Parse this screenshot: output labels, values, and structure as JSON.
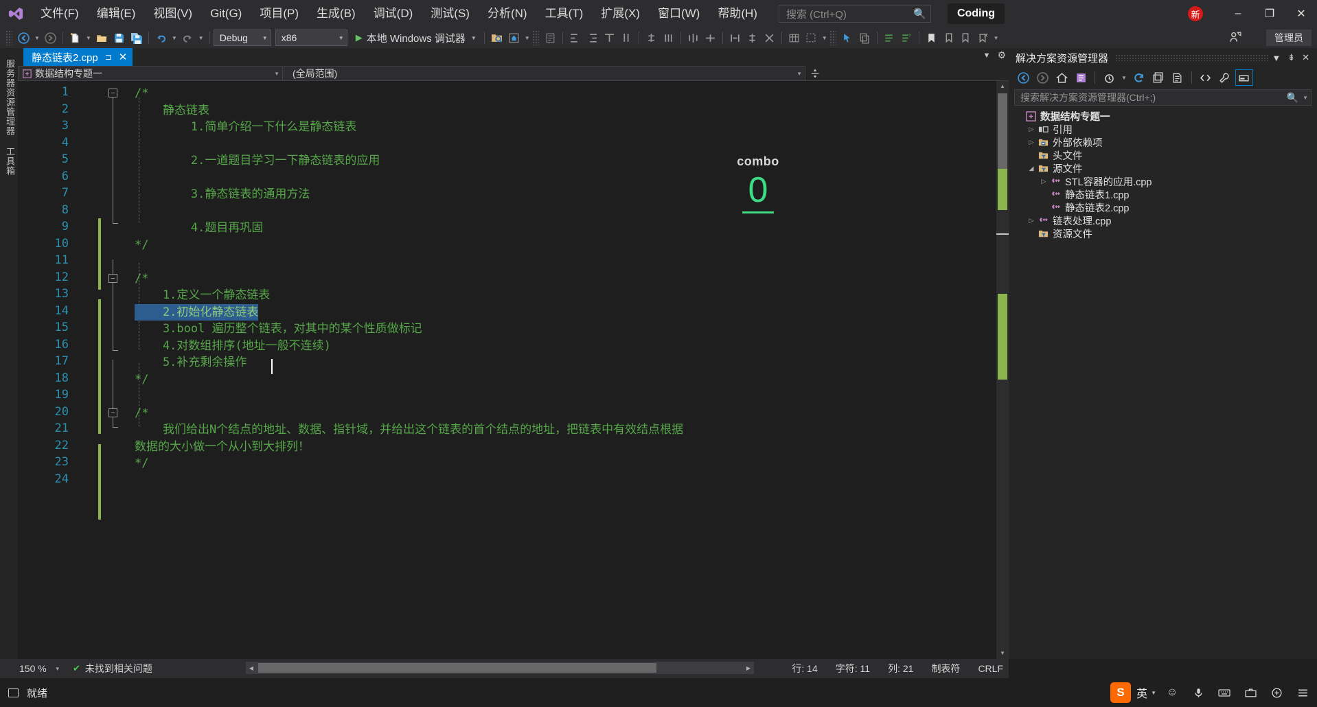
{
  "titlebar": {
    "logo_icon": "visual-studio-logo",
    "menus": [
      {
        "label": "文件(F)"
      },
      {
        "label": "编辑(E)"
      },
      {
        "label": "视图(V)"
      },
      {
        "label": "Git(G)"
      },
      {
        "label": "项目(P)"
      },
      {
        "label": "生成(B)"
      },
      {
        "label": "调试(D)"
      },
      {
        "label": "测试(S)"
      },
      {
        "label": "分析(N)"
      },
      {
        "label": "工具(T)"
      },
      {
        "label": "扩展(X)"
      },
      {
        "label": "窗口(W)"
      },
      {
        "label": "帮助(H)"
      }
    ],
    "search_placeholder": "搜索 (Ctrl+Q)",
    "search_icon": "search-icon",
    "product_tag": "Coding",
    "new_badge": "新",
    "minimize": "–",
    "restore": "❐",
    "close": "✕"
  },
  "toolbar": {
    "nav_back_icon": "arrow-back-icon",
    "nav_forward_icon": "arrow-forward-icon",
    "new_file_icon": "new-file-icon",
    "open_file_icon": "open-folder-icon",
    "save_icon": "save-icon",
    "save_all_icon": "save-all-icon",
    "undo_icon": "undo-icon",
    "redo_icon": "redo-icon",
    "config_value": "Debug",
    "platform_value": "x86",
    "run_label": "本地 Windows 调试器",
    "run_icon": "play-icon",
    "admin_label": "管理员",
    "feedback_icon": "feedback-icon"
  },
  "left_rail": {
    "tabs": [
      {
        "label": "服务器资源管理器"
      },
      {
        "label": "工具箱"
      }
    ]
  },
  "editor": {
    "tab": {
      "title": "静态链表2.cpp",
      "pin_icon": "pin-icon",
      "close_icon": "close-icon"
    },
    "breadcrumb_project": "数据结构专题一",
    "breadcrumb_project_icon": "cpp-project-icon",
    "breadcrumb_scope": "(全局范围)",
    "split_icon": "split-editor-icon",
    "settings_icon": "gear-icon",
    "lines": [
      {
        "n": 1,
        "text": "/*",
        "fold": "minus",
        "sel": false
      },
      {
        "n": 2,
        "text": "    静态链表",
        "sel": false
      },
      {
        "n": 3,
        "text": "        1.简单介绍一下什么是静态链表",
        "sel": false
      },
      {
        "n": 4,
        "text": "",
        "sel": false
      },
      {
        "n": 5,
        "text": "        2.一道题目学习一下静态链表的应用",
        "sel": false
      },
      {
        "n": 6,
        "text": "",
        "sel": false
      },
      {
        "n": 7,
        "text": "        3.静态链表的通用方法",
        "sel": false
      },
      {
        "n": 8,
        "text": "",
        "sel": false
      },
      {
        "n": 9,
        "text": "        4.题目再巩固",
        "sel": false
      },
      {
        "n": 10,
        "text": "*/",
        "sel": false
      },
      {
        "n": 11,
        "text": "",
        "sel": false
      },
      {
        "n": 12,
        "text": "/*",
        "fold": "minus",
        "sel": false
      },
      {
        "n": 13,
        "text": "    1.定义一个静态链表",
        "sel": false
      },
      {
        "n": 14,
        "text": "    2.初始化静态链表",
        "sel": true
      },
      {
        "n": 15,
        "text": "    3.bool 遍历整个链表，对其中的某个性质做标记",
        "sel": false
      },
      {
        "n": 16,
        "text": "    4.对数组排序(地址一般不连续)",
        "sel": false
      },
      {
        "n": 17,
        "text": "    5.补充剩余操作",
        "sel": false
      },
      {
        "n": 18,
        "text": "*/",
        "sel": false
      },
      {
        "n": 19,
        "text": "",
        "sel": false
      },
      {
        "n": 20,
        "text": "/*",
        "fold": "minus",
        "sel": false
      },
      {
        "n": 21,
        "text": "    我们给出N个结点的地址、数据、指针域，并给出这个链表的首个结点的地址，把链表中有效结点根据",
        "sel": false
      },
      {
        "n": 22,
        "text": "数据的大小做一个从小到大排列！",
        "sel": false
      },
      {
        "n": 23,
        "text": "*/",
        "sel": false
      },
      {
        "n": 24,
        "text": "",
        "sel": false
      }
    ]
  },
  "combo_overlay": {
    "label": "combo",
    "value": "0",
    "color": "#3ddc84"
  },
  "solution_explorer": {
    "title": "解决方案资源管理器",
    "dropdown_icon": "chevron-down-icon",
    "pin_icon": "pin-icon",
    "close_icon": "close-icon",
    "toolbar_icons": [
      "back-icon",
      "forward-icon",
      "home-icon",
      "sync-with-active-document-icon",
      "pending-changes-icon",
      "refresh-icon",
      "collapse-all-icon",
      "show-all-files-icon",
      "view-code-icon",
      "properties-icon",
      "preview-selected-items-icon"
    ],
    "search_placeholder": "搜索解决方案资源管理器(Ctrl+;)",
    "search_icon": "search-icon",
    "tree": [
      {
        "label": "数据结构专题一",
        "indent": 0,
        "twisty": "",
        "icon": "cpp-project-icon",
        "root": true
      },
      {
        "label": "引用",
        "indent": 1,
        "twisty": "▷",
        "icon": "references-icon"
      },
      {
        "label": "外部依赖项",
        "indent": 1,
        "twisty": "▷",
        "icon": "external-deps-icon"
      },
      {
        "label": "头文件",
        "indent": 1,
        "twisty": "",
        "icon": "folder-filter-icon"
      },
      {
        "label": "源文件",
        "indent": 1,
        "twisty": "◢",
        "icon": "folder-filter-icon"
      },
      {
        "label": "STL容器的应用.cpp",
        "indent": 2,
        "twisty": "▷",
        "icon": "cpp-file-icon"
      },
      {
        "label": "静态链表1.cpp",
        "indent": 2,
        "twisty": "",
        "icon": "cpp-file-icon"
      },
      {
        "label": "静态链表2.cpp",
        "indent": 2,
        "twisty": "",
        "icon": "cpp-file-icon"
      },
      {
        "label": "链表处理.cpp",
        "indent": 1,
        "twisty": "▷",
        "icon": "cpp-file-icon"
      },
      {
        "label": "资源文件",
        "indent": 1,
        "twisty": "",
        "icon": "folder-filter-icon"
      }
    ]
  },
  "editor_status": {
    "zoom": "150 %",
    "issues_icon": "check-circle-icon",
    "issues": "未找到相关问题",
    "row_label": "行: 14",
    "char_label": "字符: 11",
    "col_label": "列: 21",
    "tabs_label": "制表符",
    "eol_label": "CRLF"
  },
  "statusbar": {
    "ready_icon": "ready-box-icon",
    "ready": "就绪",
    "ime_brand": "S",
    "ime_mode": "英",
    "tray_icons": [
      "emoji-icon",
      "mic-icon",
      "keyboard-icon",
      "toolbox-icon",
      "pinyin-icon",
      "menu-icon"
    ]
  }
}
